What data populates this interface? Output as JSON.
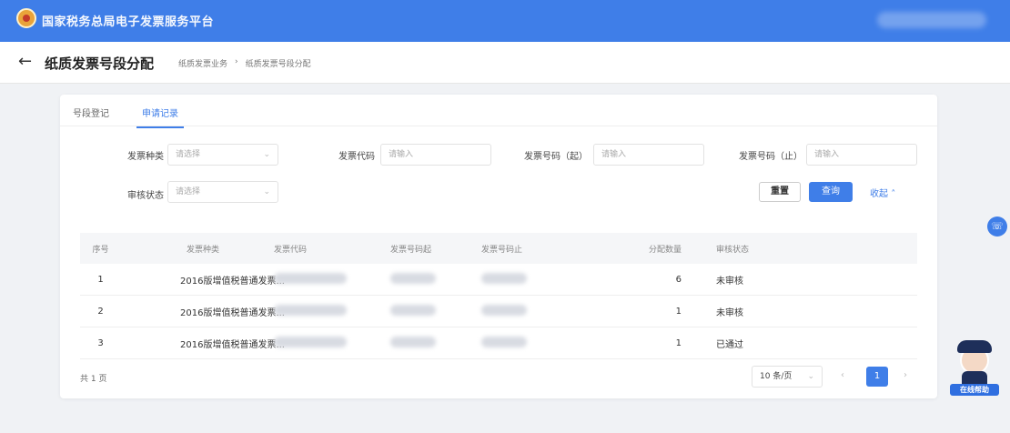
{
  "topbar": {
    "app_title": "国家税务总局电子发票服务平台"
  },
  "header": {
    "title": "纸质发票号段分配",
    "breadcrumb": [
      "纸质发票业务",
      "纸质发票号段分配"
    ]
  },
  "tabs": [
    {
      "label": "号段登记"
    },
    {
      "label": "申请记录"
    }
  ],
  "filters": {
    "invoice_type": {
      "label": "发票种类",
      "placeholder": "请选择"
    },
    "invoice_code": {
      "label": "发票代码",
      "placeholder": "请输入"
    },
    "start_no": {
      "label": "发票号码（起）",
      "placeholder": "请输入"
    },
    "end_no": {
      "label": "发票号码（止）",
      "placeholder": "请输入"
    },
    "status": {
      "label": "审核状态",
      "placeholder": "请选择"
    }
  },
  "actions": {
    "reset": "重置",
    "query": "查询",
    "collapse": "收起"
  },
  "table": {
    "headers": [
      "序号",
      "发票种类",
      "发票代码",
      "发票号码起",
      "发票号码止",
      "分配数量",
      "审核状态"
    ],
    "rows": [
      {
        "index": "1",
        "type": "2016版增值税普通发票...",
        "qty": "6",
        "status": "未审核"
      },
      {
        "index": "2",
        "type": "2016版增值税普通发票...",
        "qty": "1",
        "status": "未审核"
      },
      {
        "index": "3",
        "type": "2016版增值税普通发票...",
        "qty": "1",
        "status": "已通过"
      }
    ]
  },
  "pagination": {
    "total": "共 1 页",
    "page_size": "10 条/页",
    "current": "1"
  },
  "assistant": {
    "label": "在线帮助"
  },
  "colors": {
    "primary": "#3f7ee8",
    "page_bg": "#f0f2f5"
  }
}
